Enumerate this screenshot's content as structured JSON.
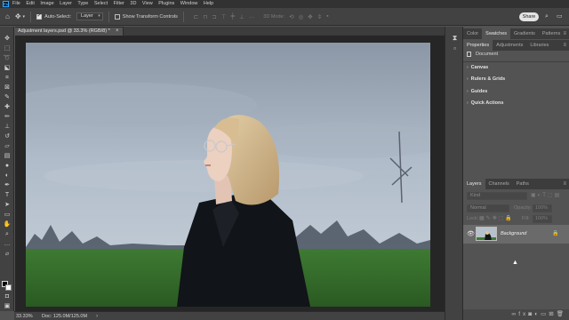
{
  "app": {
    "logo_text": "Ps"
  },
  "menu": [
    "File",
    "Edit",
    "Image",
    "Layer",
    "Type",
    "Select",
    "Filter",
    "3D",
    "View",
    "Plugins",
    "Window",
    "Help"
  ],
  "options_bar": {
    "auto_select_label": "Auto-Select:",
    "auto_select_checked": true,
    "auto_select_target": "Layer",
    "transform_controls_label": "Show Transform Controls",
    "transform_controls_checked": false,
    "mode_3d_label": "3D Mode:",
    "share_label": "Share"
  },
  "document": {
    "tab_title": "Adjustment layers.psd @ 33.3% (RGB/8) *",
    "close_glyph": "×"
  },
  "status_bar": {
    "zoom": "33.33%",
    "doc_size": "Doc: 125.0M/125.0M",
    "arrow": "›"
  },
  "color_panel": {
    "tabs": [
      "Color",
      "Swatches",
      "Gradients",
      "Patterns"
    ],
    "active_tab": "Swatches"
  },
  "properties_panel": {
    "tabs": [
      "Properties",
      "Adjustments",
      "Libraries"
    ],
    "active_tab": "Properties",
    "document_label": "Document",
    "sections": [
      "Canvas",
      "Rulers & Grids",
      "Guides",
      "Quick Actions"
    ]
  },
  "layers_panel": {
    "tabs": [
      "Layers",
      "Channels",
      "Paths"
    ],
    "active_tab": "Layers",
    "search_placeholder": "Kind",
    "blend_mode": "Normal",
    "opacity_label": "Opacity:",
    "opacity_value": "100%",
    "lock_label": "Lock:",
    "fill_label": "Fill:",
    "fill_value": "100%",
    "layers": [
      {
        "name": "Background",
        "visible": true,
        "locked": true
      }
    ]
  },
  "colors": {
    "foreground": "#000000",
    "background": "#ffffff",
    "accent": "#31a8ff"
  }
}
